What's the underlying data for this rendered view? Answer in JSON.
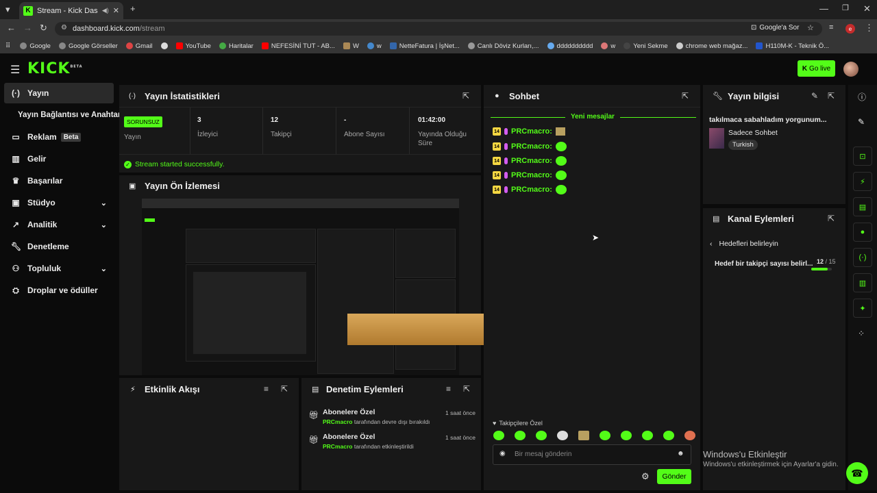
{
  "browser": {
    "tab_title": "Stream - Kick Dashboard",
    "url_host": "dashboard.kick.com",
    "url_path": "/stream",
    "google_lens": "Google'a Sor",
    "bookmarks": [
      "Google",
      "Google Görseller",
      "Gmail",
      "",
      "YouTube",
      "Haritalar",
      "NEFESİNİ TUT - AB...",
      "W",
      "w",
      "NetteFatura | İşNet...",
      "Canlı Döviz Kurları,...",
      "dddddddddd",
      "w",
      "Yeni Sekme",
      "chrome web mağaz...",
      "H110M-K - Teknik Ö..."
    ]
  },
  "header": {
    "logo": "KICK",
    "logo_tag": "BETA",
    "golive_label": "Go live"
  },
  "sidebar": {
    "items": [
      {
        "label": "Yayın"
      },
      {
        "label": "Yayın Bağlantısı ve Anahtarı"
      },
      {
        "label": "Reklam",
        "badge": "Beta"
      },
      {
        "label": "Gelir"
      },
      {
        "label": "Başarılar"
      },
      {
        "label": "Stüdyo"
      },
      {
        "label": "Analitik"
      },
      {
        "label": "Denetleme"
      },
      {
        "label": "Topluluk"
      },
      {
        "label": "Droplar ve ödüller"
      }
    ]
  },
  "stats": {
    "title": "Yayın İstatistikleri",
    "status_badge": "SORUNSUZ",
    "status_label": "Yayın",
    "viewers": "3",
    "viewers_label": "İzleyici",
    "followers": "12",
    "followers_label": "Takipçi",
    "subs": "-",
    "subs_label": "Abone Sayısı",
    "uptime": "01:42:00",
    "uptime_label": "Yayında Olduğu Süre",
    "success_msg": "Stream started successfully."
  },
  "preview": {
    "title": "Yayın Ön İzlemesi"
  },
  "activity": {
    "title": "Etkinlik Akışı"
  },
  "moderation": {
    "title": "Denetim Eylemleri",
    "items": [
      {
        "title": "Abonelere Özel",
        "user": "PRCmacro",
        "action": "tarafından devre dışı bırakıldı",
        "time": "1 saat önce"
      },
      {
        "title": "Abonelere Özel",
        "user": "PRCmacro",
        "action": "tarafından etkinleştirildi",
        "time": "1 saat önce"
      }
    ]
  },
  "chat": {
    "title": "Sohbet",
    "new_messages": "Yeni mesajlar",
    "messages": [
      {
        "badge": "14",
        "user": "PRCmacro:"
      },
      {
        "badge": "14",
        "user": "PRCmacro:"
      },
      {
        "badge": "14",
        "user": "PRCmacro:"
      },
      {
        "badge": "14",
        "user": "PRCmacro:"
      },
      {
        "badge": "14",
        "user": "PRCmacro:"
      }
    ],
    "followers_only": "Takipçilere Özel",
    "input_placeholder": "Bir mesaj gönderin",
    "send_label": "Gönder"
  },
  "stream_info": {
    "title": "Yayın bilgisi",
    "stream_title": "takılmaca sabahladım yorgunum...",
    "category": "Sadece Sohbet",
    "language": "Turkish"
  },
  "channel_actions": {
    "title": "Kanal Eylemleri",
    "back_label": "Hedefleri belirleyin",
    "goal_label": "Hedef bir takipçi sayısı belirl...",
    "goal_current": "12",
    "goal_total": "/ 15",
    "goal_progress": 0.8
  },
  "windows": {
    "activate_title": "Windows'u Etkinleştir",
    "activate_sub": "Windows'u etkinleştirmek için Ayarlar'a gidin."
  }
}
